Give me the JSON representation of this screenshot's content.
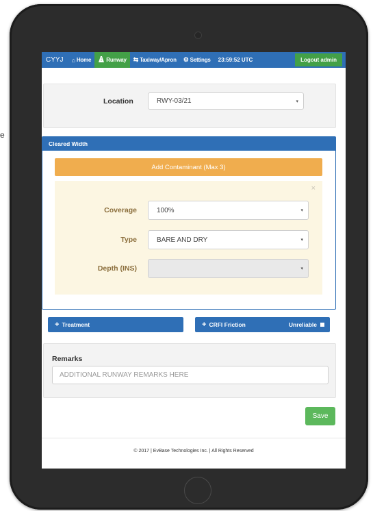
{
  "stray_text": "e",
  "navbar": {
    "brand": "CYYJ",
    "items": [
      {
        "label": "Home",
        "icon": "home-icon",
        "active": false
      },
      {
        "label": "Runway",
        "icon": "runway-icon",
        "active": true
      },
      {
        "label": "Taxiway/Apron",
        "icon": "exchange-icon",
        "active": false
      },
      {
        "label": "Settings",
        "icon": "gear-icon",
        "active": false
      }
    ],
    "clock": "23:59:52 UTC",
    "logout_label": "Logout admin"
  },
  "location": {
    "label": "Location",
    "value": "RWY-03/21"
  },
  "cleared_width": {
    "title": "Cleared Width",
    "add_button": "Add Contaminant (Max 3)",
    "contaminant": {
      "coverage_label": "Coverage",
      "coverage_value": "100%",
      "type_label": "Type",
      "type_value": "BARE AND DRY",
      "depth_label": "Depth (INS)",
      "depth_value": ""
    }
  },
  "buttons": {
    "treatment": "Treatment",
    "crfi": "CRFI Friction",
    "unreliable": "Unreliable"
  },
  "remarks": {
    "label": "Remarks",
    "placeholder": "ADDITIONAL RUNWAY REMARKS HERE"
  },
  "save_label": "Save",
  "footer": "© 2017 | EvBase Technologies Inc. | All Rights Reserved",
  "colors": {
    "primary": "#2f6fb6",
    "success": "#43a047",
    "warning": "#f0ad4e",
    "contaminant_bg": "#fcf6e2"
  }
}
